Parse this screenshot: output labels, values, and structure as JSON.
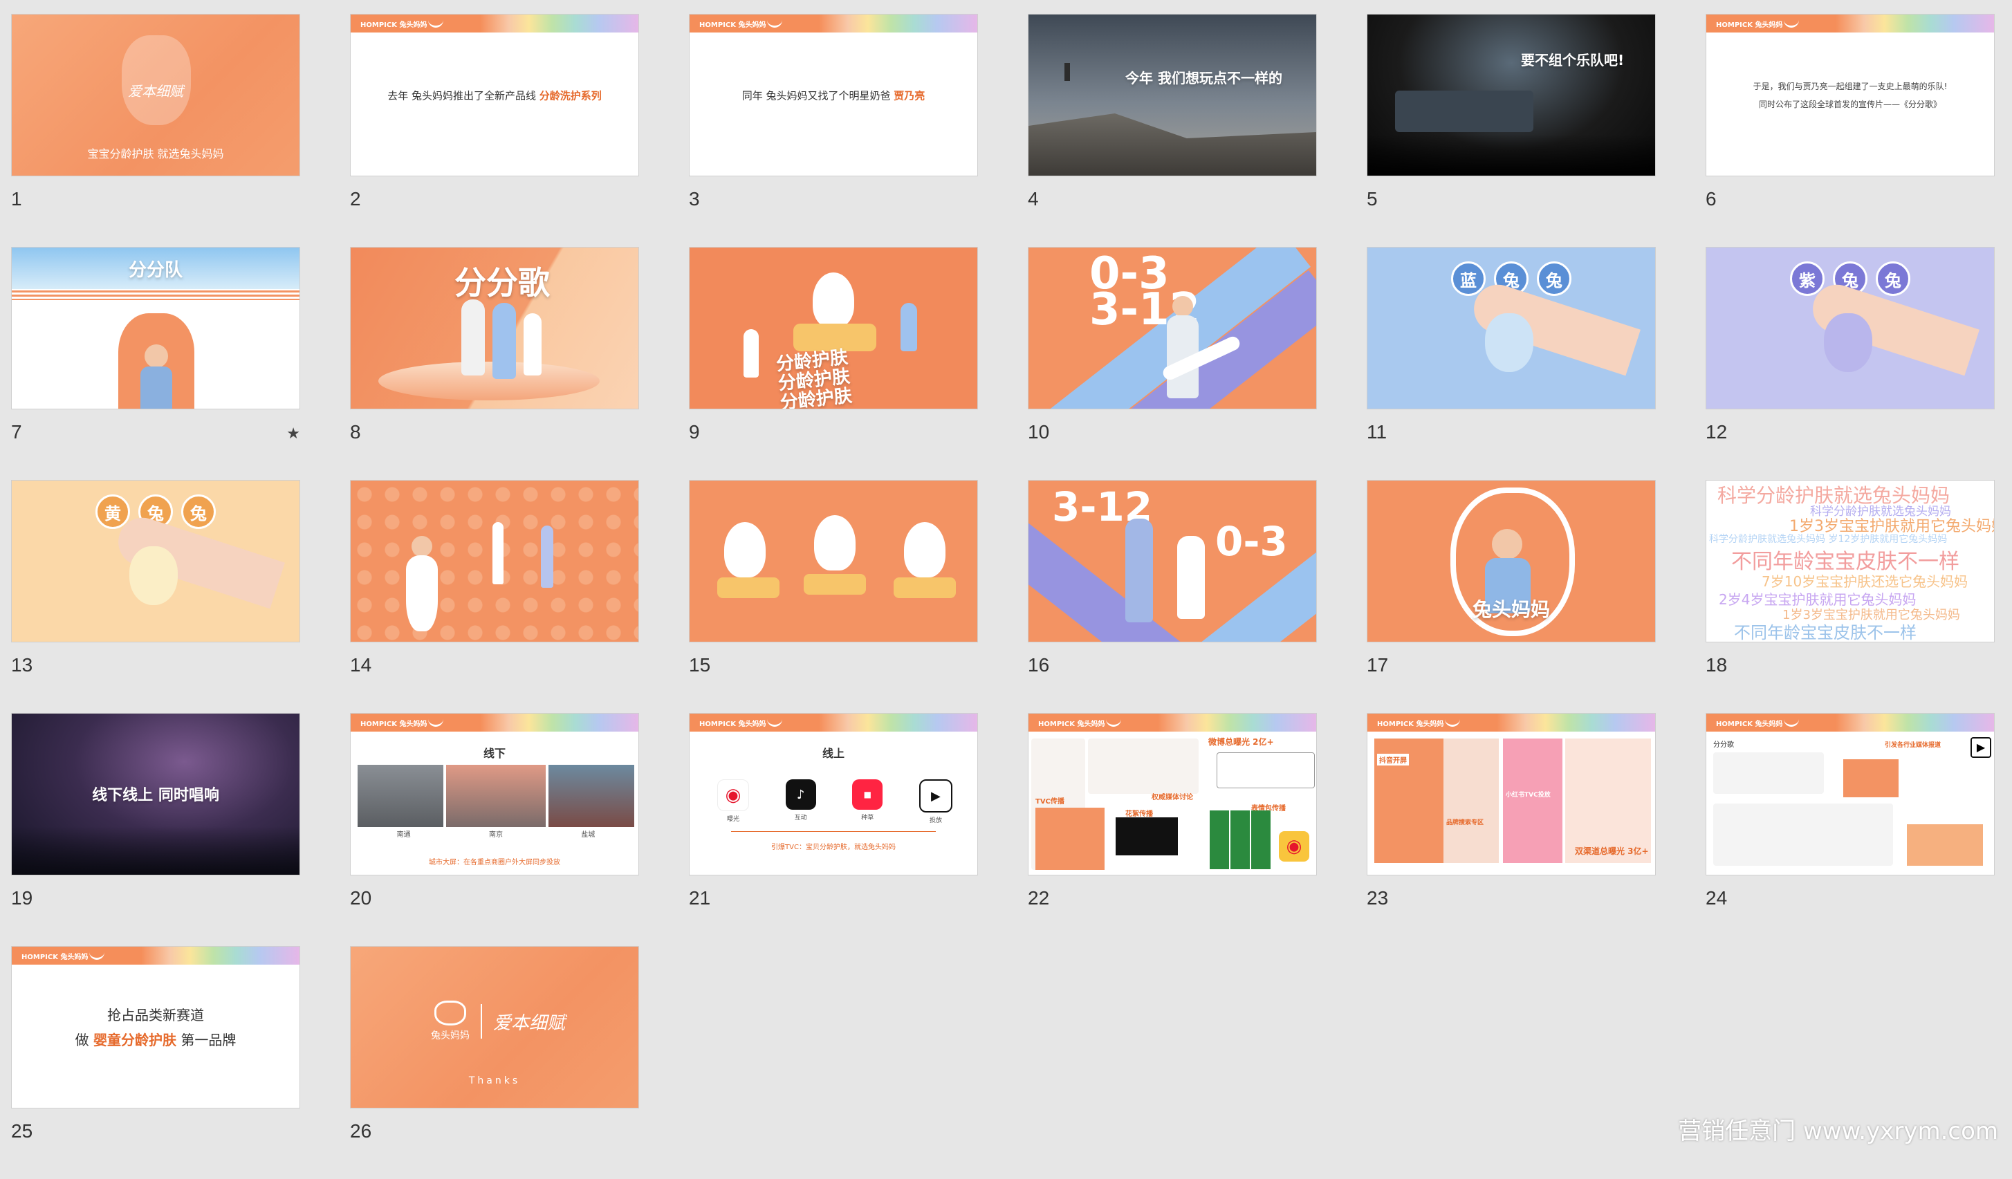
{
  "colors": {
    "background": "#e6e6e6",
    "brand_orange": "#f39363",
    "highlight": "#e66a2c",
    "blue": "#a9c9ef",
    "purple": "#c4c5f0",
    "yellow": "#fbd8a8"
  },
  "header_brand": "HOMPICK 兔头妈妈",
  "slides": [
    {
      "num": "1",
      "title": "爱本细赋",
      "subtitle": "宝宝分龄护肤 就选兔头妈妈"
    },
    {
      "num": "2",
      "text_prefix": "去年 兔头妈妈推出了全新产品线 ",
      "text_highlight": "分龄洗护系列"
    },
    {
      "num": "3",
      "text_prefix": "同年 兔头妈妈又找了个明星奶爸 ",
      "text_highlight": "贾乃亮"
    },
    {
      "num": "4",
      "title": "今年 我们想玩点不一样的"
    },
    {
      "num": "5",
      "title": "要不组个乐队吧!"
    },
    {
      "num": "6",
      "line1": "于是，我们与贾乃亮一起组建了一支史上最萌的乐队!",
      "line2": "同时公布了这段全球首发的宣传片——《分分歌》"
    },
    {
      "num": "7",
      "title": "分分队"
    },
    {
      "num": "8",
      "title": "分分歌"
    },
    {
      "num": "9",
      "lines": [
        "分龄护肤",
        "分龄护肤",
        "分龄护肤"
      ]
    },
    {
      "num": "10",
      "big1": "0-3",
      "big2": "3-12"
    },
    {
      "num": "11",
      "chars": [
        "蓝",
        "兔",
        "兔"
      ]
    },
    {
      "num": "12",
      "chars": [
        "紫",
        "兔",
        "兔"
      ]
    },
    {
      "num": "13",
      "chars": [
        "黄",
        "兔",
        "兔"
      ]
    },
    {
      "num": "14"
    },
    {
      "num": "15"
    },
    {
      "num": "16",
      "big1": "3-12",
      "big2": "0-3"
    },
    {
      "num": "17",
      "title": "兔头妈妈"
    },
    {
      "num": "18",
      "words": [
        "科学分龄护肤就选兔头妈妈",
        "科学分龄护肤就选兔头妈妈",
        "1岁3岁宝宝护肤就用它兔头妈妈",
        "科学分龄护肤就选兔头妈妈 岁12岁护肤就用它兔头妈妈",
        "不同年龄宝宝皮肤不一样",
        "7岁10岁宝宝护肤还选它兔头妈妈",
        "2岁4岁宝宝护肤就用它兔头妈妈",
        "1岁3岁宝宝护肤就用它兔头妈妈",
        "不同年龄宝宝皮肤不一样"
      ]
    },
    {
      "num": "19",
      "title": "线下线上 同时唱响"
    },
    {
      "num": "20",
      "title": "线下",
      "cities": [
        "南通",
        "南京",
        "盐城"
      ],
      "caption": "城市大屏：在各重点商圈户外大屏同步投放"
    },
    {
      "num": "21",
      "title": "线上",
      "platforms": [
        "曝光",
        "互动",
        "种草",
        "投放"
      ],
      "caption": "引爆TVC：宝贝分龄护肤，就选兔头妈妈"
    },
    {
      "num": "22",
      "headline": "微博总曝光 2亿+",
      "label1": "TVC传播",
      "label2": "权威媒体讨论",
      "label3": "花絮传播",
      "label4": "表情包传播"
    },
    {
      "num": "23",
      "headline": "双渠道总曝光 3亿+",
      "label1": "抖音开屏",
      "label2": "品牌搜索专区",
      "label3": "小红书TVC投放"
    },
    {
      "num": "24",
      "title": "分分歌",
      "label1": "引发各行业媒体报道"
    },
    {
      "num": "25",
      "line1": "抢占品类新赛道",
      "line2_prefix": "做 ",
      "line2_highlight": "婴童分龄护肤",
      "line2_suffix": " 第一品牌"
    },
    {
      "num": "26",
      "logo1": "兔头妈妈",
      "logo2": "爱本细赋",
      "thanks": "Thanks"
    }
  ],
  "watermark": "营销任意门 www.yxrym.com"
}
